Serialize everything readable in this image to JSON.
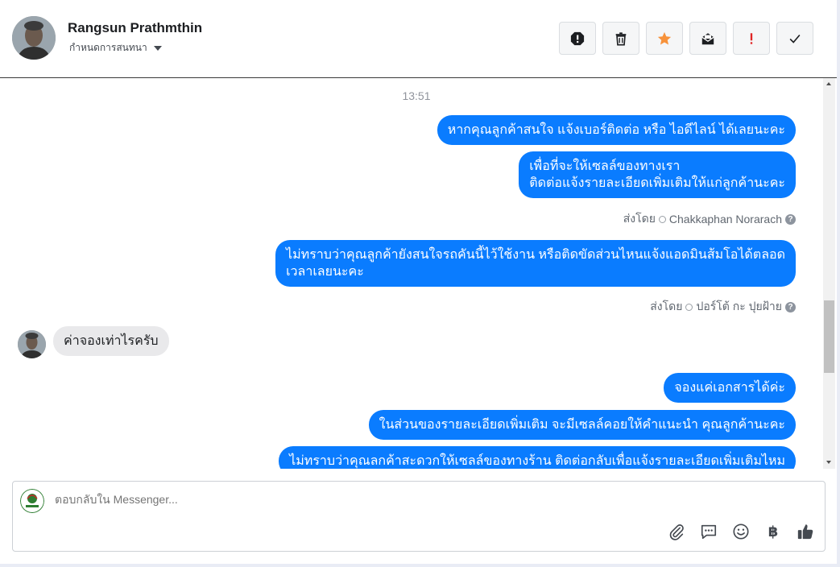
{
  "contact": {
    "name": "Rangsun Prathmthin",
    "menu_label": "กำหนดการสนทนา"
  },
  "actions": [
    {
      "name": "spam-button",
      "icon": "alert-octagon-icon"
    },
    {
      "name": "delete-button",
      "icon": "trash-icon"
    },
    {
      "name": "star-button",
      "icon": "star-icon",
      "color": "#f7923b"
    },
    {
      "name": "mark-unread-button",
      "icon": "envelope-icon"
    },
    {
      "name": "follow-up-button",
      "icon": "exclamation-icon",
      "color": "#e02424"
    },
    {
      "name": "mark-done-button",
      "icon": "check-icon"
    }
  ],
  "chat": {
    "timestamp": "13:51",
    "messages": [
      {
        "text": "หากคุณลูกค้าสนใจ แจ้งเบอร์ติดต่อ หรือ ไอดีไลน์ ได้เลยนะคะ"
      },
      {
        "line1": "เพื่อที่จะให้เซลล์ของทางเรา",
        "line2": "ติดต่อแจ้งรายละเอียดเพิ่มเติมให้แก่ลูกค้านะคะ"
      },
      {
        "line1": "ไม่ทราบว่าคุณลูกค้ายังสนใจรถคันนี้ไว้ใช้งาน หรือติดขัดส่วนไหนแจ้งแอดมินส้มโอได้ตลอด",
        "line2": "เวลาเลยนะคะ"
      },
      {
        "text": "ค่าจองเท่าไรครับ"
      },
      {
        "text": "จองแค่เอกสารได้ค่ะ"
      },
      {
        "text": "ในส่วนของรายละเอียดเพิ่มเติม จะมีเซลล์คอยให้คำแนะนำ คุณลูกค้านะคะ"
      },
      {
        "text": "ไม่ทราบว่าคุณลกค้าสะดวกให้เซลล์ของทางร้าน ติดต่อกลับเพื่อแจ้งรายละเอียดเพิ่มเติมไหม"
      }
    ],
    "sent_by_prefix": "ส่งโดย",
    "sender_1": "Chakkaphan Norarach",
    "sender_2": "ปอร์โต้ กะ ปุยฝ้าย"
  },
  "composer": {
    "placeholder": "ตอบกลับใน Messenger...",
    "tools": [
      "paperclip-icon",
      "saved-replies-icon",
      "emoji-icon",
      "baht-icon",
      "thumbs-up-icon"
    ],
    "baht_symbol": "฿"
  },
  "colors": {
    "accent": "#0a7cff",
    "incoming": "#e9e9eb"
  }
}
